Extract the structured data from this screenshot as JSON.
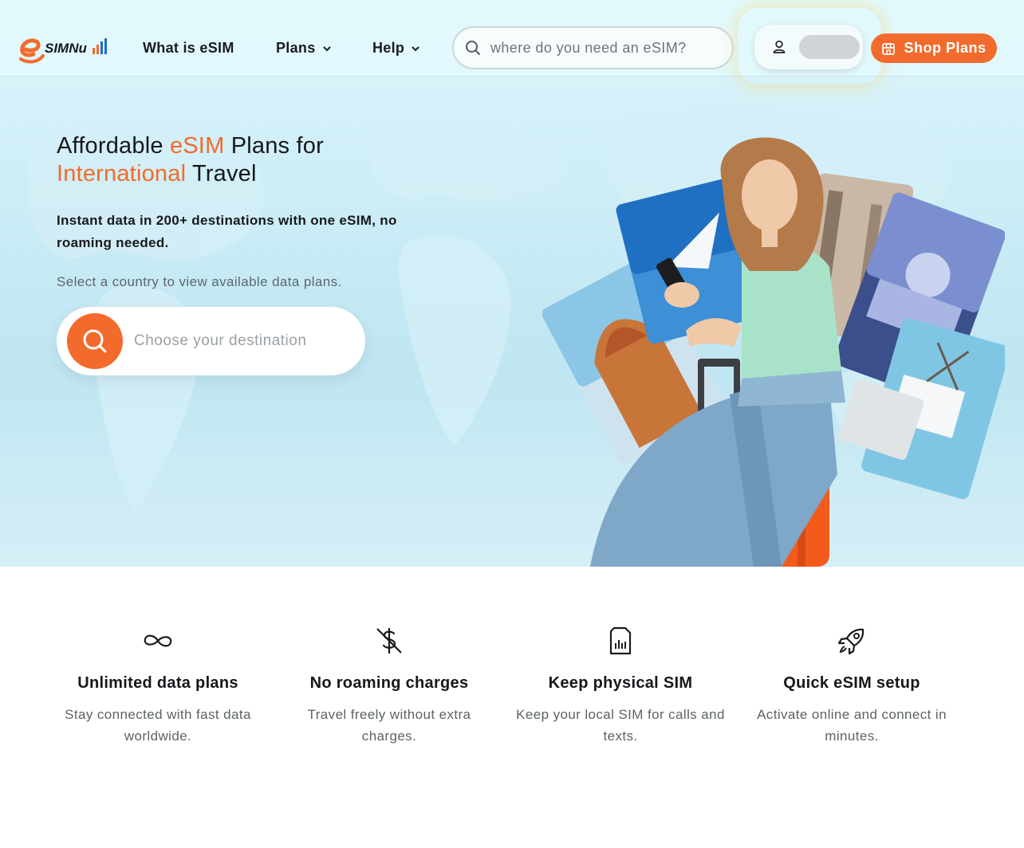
{
  "brand": {
    "name": "eSIMNum",
    "accent_color": "#f26b2c"
  },
  "nav": {
    "links": [
      {
        "label": "What is eSIM"
      },
      {
        "label": "Plans"
      },
      {
        "label": "Help"
      }
    ],
    "search_placeholder": "where do you need an eSIM?",
    "shop_label": "Shop Plans"
  },
  "hero": {
    "title_part1": "Affordable ",
    "title_accent1": "eSIM",
    "title_part2": " Plans for",
    "title_accent2": "International",
    "title_part3": " Travel",
    "subtitle": "Instant data in 200+ destinations with one eSIM, no roaming needed.",
    "hint": "Select a country to view available data plans.",
    "destination_placeholder": "Choose your destination"
  },
  "features": [
    {
      "icon": "infinity-icon",
      "title": "Unlimited data plans",
      "description": "Stay connected with fast data worldwide."
    },
    {
      "icon": "no-dollar-icon",
      "title": "No roaming charges",
      "description": "Travel freely without extra charges."
    },
    {
      "icon": "sim-card-icon",
      "title": "Keep physical SIM",
      "description": "Keep your local SIM for calls and texts."
    },
    {
      "icon": "rocket-icon",
      "title": "Quick eSIM setup",
      "description": "Activate online and connect in minutes."
    }
  ]
}
